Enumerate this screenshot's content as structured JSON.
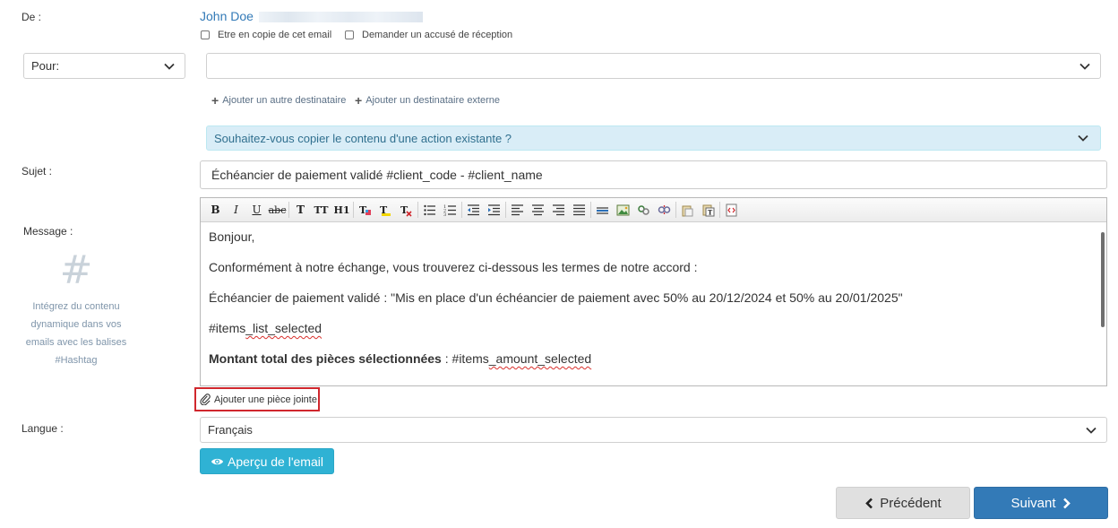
{
  "from": {
    "label": "De :",
    "sender_name": "John Doe",
    "cc_self_label": "Etre en copie de cet email",
    "receipt_label": "Demander un accusé de réception"
  },
  "recipients": {
    "type_select": "Pour:",
    "recipient_value": "",
    "add_internal": "Ajouter un autre destinataire",
    "add_external": "Ajouter un destinataire externe"
  },
  "copy_action": {
    "label": "Souhaitez-vous copier le contenu d'une action existante ?"
  },
  "subject": {
    "label": "Sujet :",
    "value": "Échéancier de paiement validé #client_code - #client_name"
  },
  "message": {
    "label": "Message :",
    "hashtag_help": {
      "symbol": "#",
      "line1": "Intégrez du contenu",
      "line2": "dynamique dans vos",
      "line3": "emails avec les balises",
      "line4": "#Hashtag"
    },
    "body": {
      "greeting": "Bonjour,",
      "intro": "Conformément à notre échange, vous trouverez ci-dessous les termes de notre accord :",
      "schedule": "Échéancier de paiement validé : \"Mis en place d'un échéancier de paiement avec 50% au 20/12/2024 et 50% au 20/01/2025\"",
      "items_prefix": "#items",
      "items_suffix": "_list_selected",
      "total_label": "Montant total des pièces sélectionnées",
      "total_sep": " : #items",
      "total_suffix": "_amount_selected"
    }
  },
  "toolbar": {
    "bold": "B",
    "italic": "I",
    "underline": "U",
    "strike": "abc",
    "font": "T",
    "size": "TT",
    "heading": "H1"
  },
  "attachment": {
    "label": "Ajouter une pièce jointe"
  },
  "language": {
    "label": "Langue :",
    "value": "Français"
  },
  "actions": {
    "preview": "Aperçu de l'email",
    "previous": "Précédent",
    "next": "Suivant"
  },
  "colors": {
    "link": "#337ab7",
    "info_bg": "#d9edf7",
    "primary": "#337ab7",
    "preview_btn": "#2fb2d4",
    "highlight_border": "#d0272d"
  }
}
